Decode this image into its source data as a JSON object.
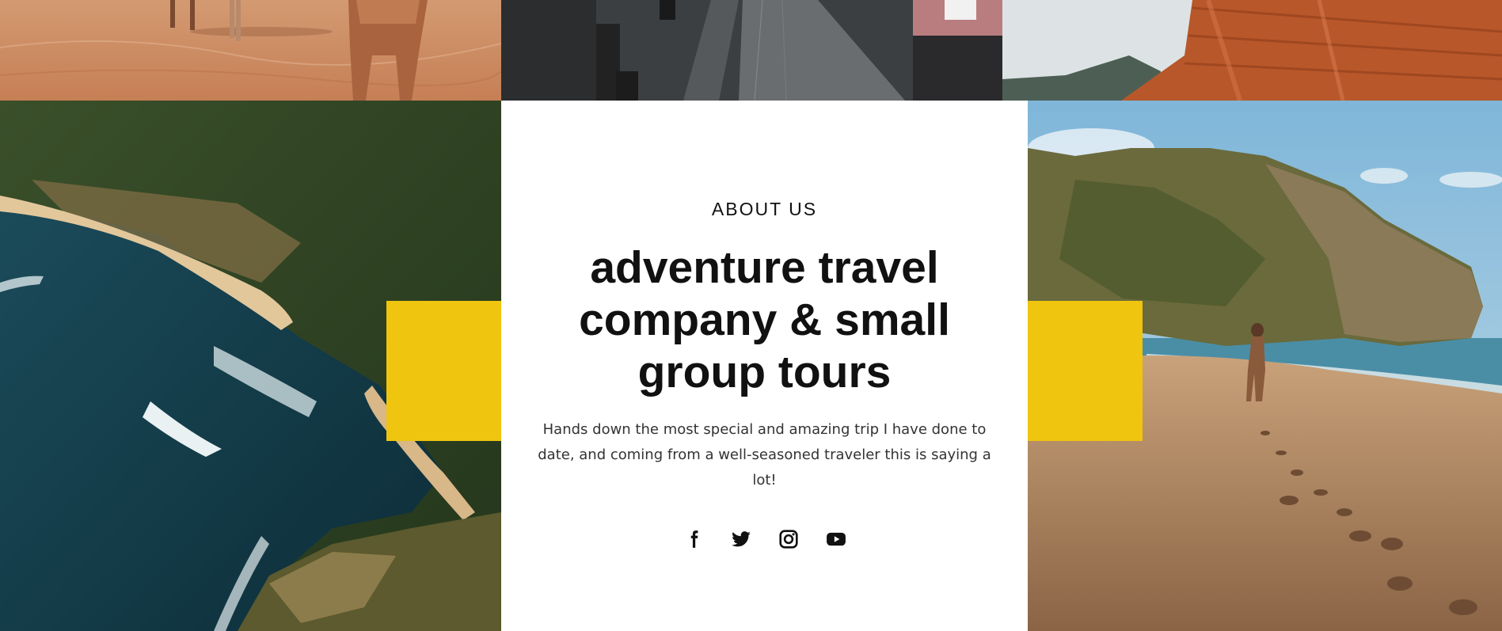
{
  "about": {
    "kicker": "ABOUT US",
    "headline_line1": "adventure travel",
    "headline_line2": "company & small",
    "headline_line3": "group tours",
    "body": "Hands down the most special and amazing trip I have done to date, and coming from a well-seasoned traveler this is saying a lot!"
  },
  "social": [
    {
      "icon": "facebook-icon"
    },
    {
      "icon": "twitter-icon"
    },
    {
      "icon": "instagram-icon"
    },
    {
      "icon": "youtube-icon"
    }
  ],
  "colors": {
    "accent_yellow": "#efc50f",
    "text_dark": "#111111",
    "body_text": "#333333",
    "card_background": "#ffffff"
  }
}
